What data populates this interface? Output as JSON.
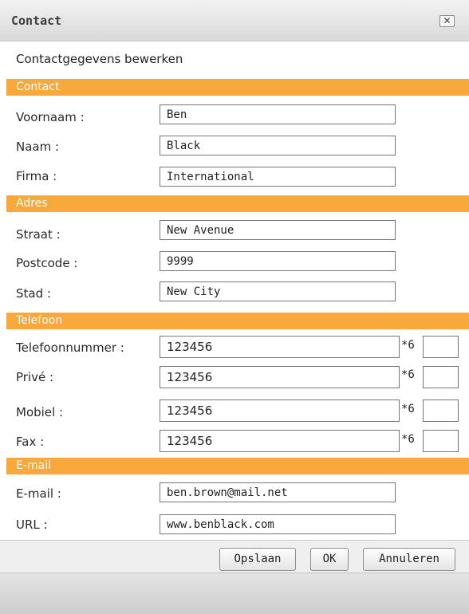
{
  "window": {
    "title": "Contact",
    "close_icon": "close-icon"
  },
  "subtitle": "Contactgegevens bewerken",
  "sections": {
    "contact": "Contact",
    "adres": "Adres",
    "telefoon": "Telefoon",
    "email": "E-mail"
  },
  "fields": {
    "voornaam": {
      "label": "Voornaam :",
      "value": "Ben"
    },
    "naam": {
      "label": "Naam :",
      "value": "Black"
    },
    "firma": {
      "label": "Firma :",
      "value": "International"
    },
    "straat": {
      "label": "Straat :",
      "value": "New Avenue"
    },
    "postcode": {
      "label": "Postcode :",
      "value": "9999"
    },
    "stad": {
      "label": "Stad :",
      "value": "New City"
    },
    "telefoonnummer": {
      "label": "Telefoonnummer :",
      "value": "123456",
      "ext_label": "*6",
      "ext_value": ""
    },
    "prive": {
      "label": "Privé :",
      "value": "123456",
      "ext_label": "*6",
      "ext_value": ""
    },
    "mobiel": {
      "label": "Mobiel :",
      "value": "123456",
      "ext_label": "*6",
      "ext_value": ""
    },
    "fax": {
      "label": "Fax :",
      "value": "123456",
      "ext_label": "*6",
      "ext_value": ""
    },
    "email": {
      "label": "E-mail :",
      "value": "ben.brown@mail.net"
    },
    "url": {
      "label": "URL :",
      "value": "www.benblack.com"
    }
  },
  "buttons": {
    "save": "Opslaan",
    "ok": "OK",
    "cancel": "Annuleren"
  },
  "colors": {
    "section_header": "#f9a83c",
    "titlebar": "#d9d9d9"
  }
}
